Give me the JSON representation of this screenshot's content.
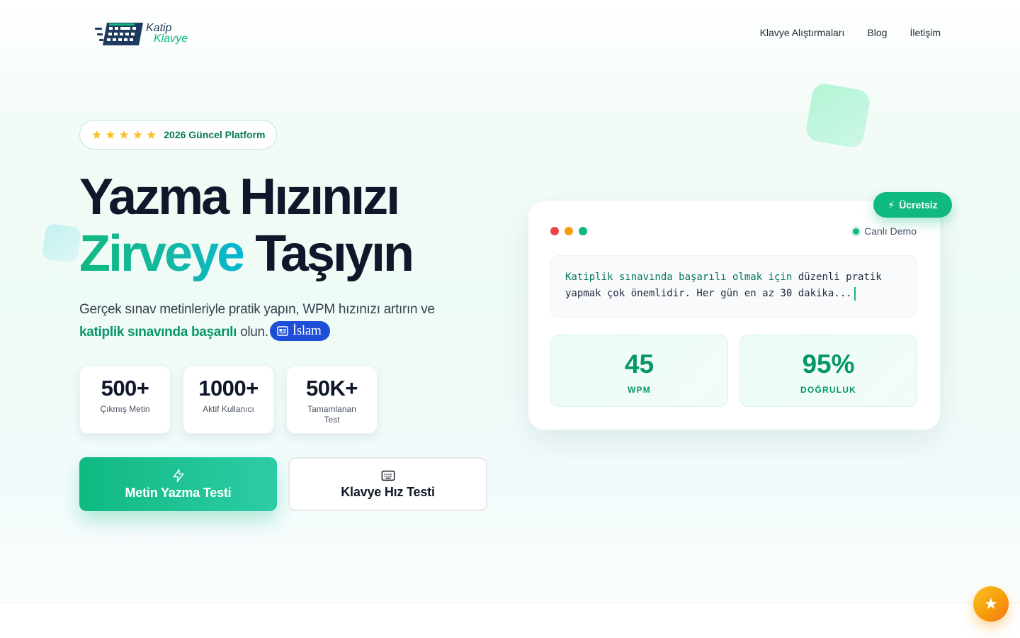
{
  "header": {
    "logo_line1": "Katip",
    "logo_line2": "Klavye",
    "nav": [
      "Klavye Alıştırmaları",
      "Blog",
      "İletişim"
    ]
  },
  "hero": {
    "badge_stars": 5,
    "badge_text": "2026 Güncel Platform",
    "title_line1": "Yazma Hızınızı",
    "title_accent": "Zirveye",
    "title_rest": "Taşıyın",
    "subtitle_part1": "Gerçek sınav metinleriyle pratik yapın, WPM hızınızı artırın ve",
    "subtitle_emphasis": "katiplik sınavında başarılı",
    "subtitle_part2": "olun.",
    "tag_label": "İslam"
  },
  "stats": [
    {
      "value": "500+",
      "label": "Çıkmış Metin"
    },
    {
      "value": "1000+",
      "label": "Aktif Kullanıcı"
    },
    {
      "value": "50K+",
      "label": "Tamamlanan Test"
    }
  ],
  "cta": {
    "primary_label": "Metin Yazma Testi",
    "primary_icon": "lightning-icon",
    "secondary_label": "Klavye Hız Testi",
    "secondary_icon": "keyboard-icon"
  },
  "demo": {
    "free_badge": "Ücretsiz",
    "live_label": "Canlı Demo",
    "typed_text": "Katiplik sınavında başarılı olmak için",
    "remaining_text_1": " düzenli pratik",
    "remaining_text_2": "yapmak çok önemlidir. Her gün en az 30 dakika...",
    "wpm_value": "45",
    "wpm_label": "WPM",
    "accuracy_value": "95%",
    "accuracy_label": "DOĞRULUK"
  },
  "colors": {
    "accent": "#10b981",
    "accent_dark": "#059669",
    "heading": "#0f172a",
    "tag_blue": "#1d4ed8",
    "dot_red": "#ef4444",
    "dot_yellow": "#f59e0b",
    "dot_green": "#10b981"
  },
  "fab_icon": "star-icon"
}
